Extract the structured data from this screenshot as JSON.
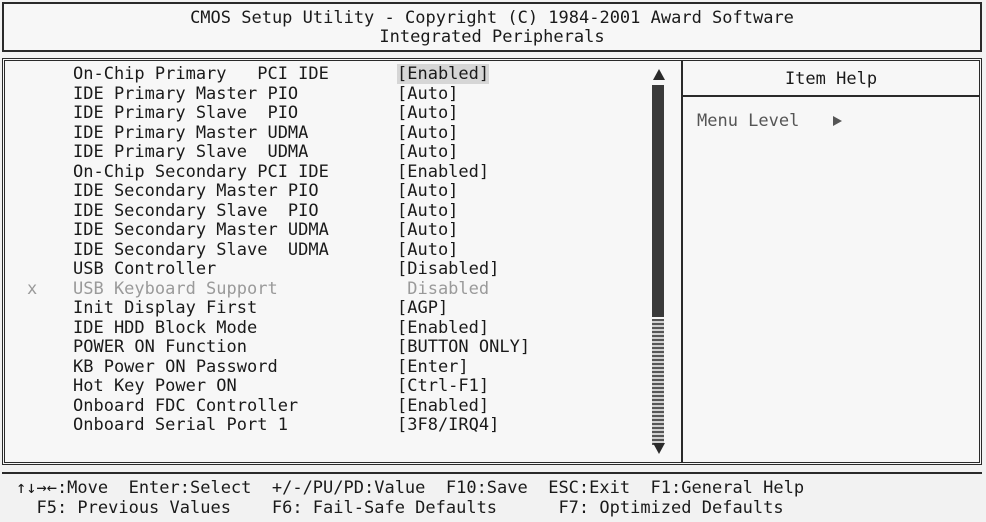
{
  "header": {
    "title": "CMOS Setup Utility - Copyright (C) 1984-2001 Award Software",
    "subtitle": "Integrated Peripherals"
  },
  "items": [
    {
      "label": "On-Chip Primary   PCI IDE",
      "value": "[Enabled]",
      "selected": true,
      "disabled": false,
      "mark": ""
    },
    {
      "label": "IDE Primary Master PIO",
      "value": "[Auto]",
      "selected": false,
      "disabled": false,
      "mark": ""
    },
    {
      "label": "IDE Primary Slave  PIO",
      "value": "[Auto]",
      "selected": false,
      "disabled": false,
      "mark": ""
    },
    {
      "label": "IDE Primary Master UDMA",
      "value": "[Auto]",
      "selected": false,
      "disabled": false,
      "mark": ""
    },
    {
      "label": "IDE Primary Slave  UDMA",
      "value": "[Auto]",
      "selected": false,
      "disabled": false,
      "mark": ""
    },
    {
      "label": "On-Chip Secondary PCI IDE",
      "value": "[Enabled]",
      "selected": false,
      "disabled": false,
      "mark": ""
    },
    {
      "label": "IDE Secondary Master PIO",
      "value": "[Auto]",
      "selected": false,
      "disabled": false,
      "mark": ""
    },
    {
      "label": "IDE Secondary Slave  PIO",
      "value": "[Auto]",
      "selected": false,
      "disabled": false,
      "mark": ""
    },
    {
      "label": "IDE Secondary Master UDMA",
      "value": "[Auto]",
      "selected": false,
      "disabled": false,
      "mark": ""
    },
    {
      "label": "IDE Secondary Slave  UDMA",
      "value": "[Auto]",
      "selected": false,
      "disabled": false,
      "mark": ""
    },
    {
      "label": "USB Controller",
      "value": "[Disabled]",
      "selected": false,
      "disabled": false,
      "mark": ""
    },
    {
      "label": "USB Keyboard Support",
      "value": " Disabled",
      "selected": false,
      "disabled": true,
      "mark": "x"
    },
    {
      "label": "Init Display First",
      "value": "[AGP]",
      "selected": false,
      "disabled": false,
      "mark": ""
    },
    {
      "label": "IDE HDD Block Mode",
      "value": "[Enabled]",
      "selected": false,
      "disabled": false,
      "mark": ""
    },
    {
      "label": "POWER ON Function",
      "value": "[BUTTON ONLY]",
      "selected": false,
      "disabled": false,
      "mark": ""
    },
    {
      "label": "KB Power ON Password",
      "value": "[Enter]",
      "selected": false,
      "disabled": false,
      "mark": ""
    },
    {
      "label": "Hot Key Power ON",
      "value": "[Ctrl-F1]",
      "selected": false,
      "disabled": false,
      "mark": ""
    },
    {
      "label": "Onboard FDC Controller",
      "value": "[Enabled]",
      "selected": false,
      "disabled": false,
      "mark": ""
    },
    {
      "label": "Onboard Serial Port 1",
      "value": "[3F8/IRQ4]",
      "selected": false,
      "disabled": false,
      "mark": ""
    }
  ],
  "help": {
    "title": "Item Help",
    "menu_level": "Menu Level"
  },
  "footer": {
    "line1": "↑↓→←:Move  Enter:Select  +/-/PU/PD:Value  F10:Save  ESC:Exit  F1:General Help",
    "line2": "  F5: Previous Values    F6: Fail-Safe Defaults      F7: Optimized Defaults"
  },
  "colors": {
    "background": "#f7f7f7",
    "text": "#1a1a1a",
    "disabled_text": "#9a9a9a",
    "highlight": "#d6d6d6"
  }
}
